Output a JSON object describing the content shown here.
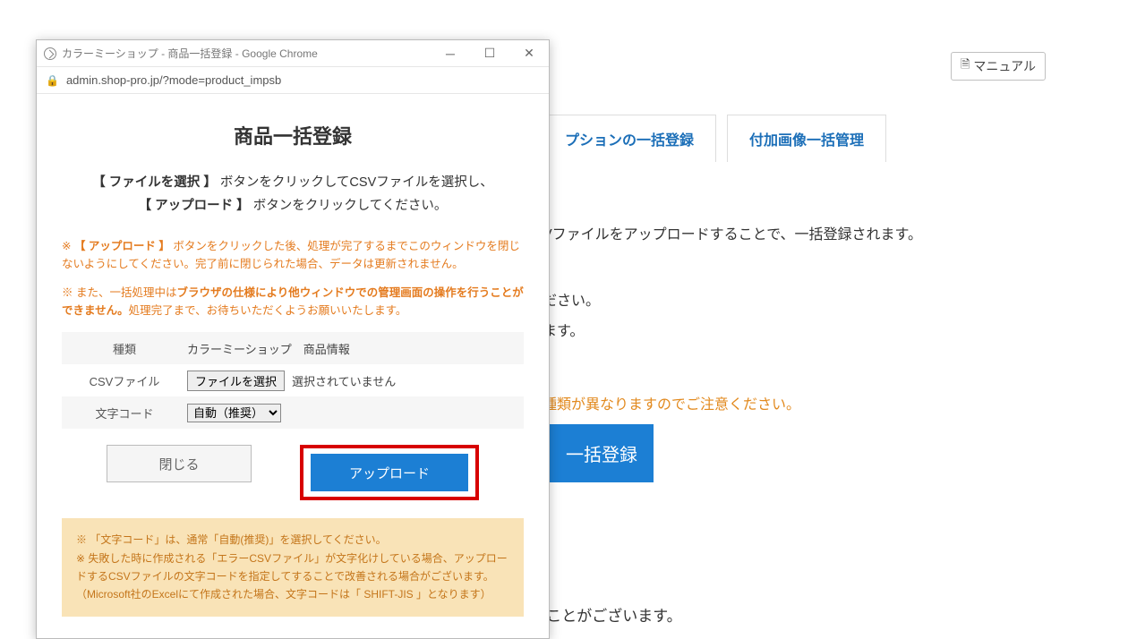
{
  "bg": {
    "manual_btn": "マニュアル",
    "tabs": [
      "プションの一括登録",
      "付加画像一括管理"
    ],
    "line1": "Vファイルをアップロードすることで、一括登録されます。",
    "line2": "ださい。",
    "line3": "ます。",
    "warn": "種類が異なりますのでご注意ください。",
    "big_btn": "一括登録",
    "bottom": "CSVファイルの記入内容に誤りがありますと、一括登録に失敗することがございます。"
  },
  "popup": {
    "window_title": "カラーミーショップ - 商品一括登録 - Google Chrome",
    "url": "admin.shop-pro.jp/?mode=product_impsb",
    "heading": "商品一括登録",
    "instr_line1_pre": "【 ファイルを選択 】",
    "instr_line1_post": " ボタンをクリックしてCSVファイルを選択し、",
    "instr_line2_pre": "【 アップロード 】",
    "instr_line2_post": " ボタンをクリックしてください。",
    "warn1_pre": "※ ",
    "warn1_bold": "【 アップロード 】",
    "warn1_post": " ボタンをクリックした後、処理が完了するまでこのウィンドウを閉じないようにしてください。完了前に閉じられた場合、データは更新されません。",
    "warn2_pre": "※ また、一括処理中は",
    "warn2_bold": "ブラウザの仕様により他ウィンドウでの管理画面の操作を行うことができません。",
    "warn2_post": "処理完了まで、お待ちいただくようお願いいたします。",
    "rows": {
      "type_label": "種類",
      "type_value": "カラーミーショップ　商品情報",
      "csv_label": "CSVファイル",
      "file_btn": "ファイルを選択",
      "file_status": "選択されていません",
      "enc_label": "文字コード",
      "enc_value": "自動（推奨）"
    },
    "close_btn": "閉じる",
    "upload_btn": "アップロード",
    "note": "※ 「文字コード」は、通常「自動(推奨)」を選択してください。\n※ 失敗した時に作成される「エラーCSVファイル」が文字化けしている場合、アップロードするCSVファイルの文字コードを指定してすることで改善される場合がございます。（Microsoft社のExcelにて作成された場合、文字コードは「 SHIFT-JIS 」となります）"
  }
}
